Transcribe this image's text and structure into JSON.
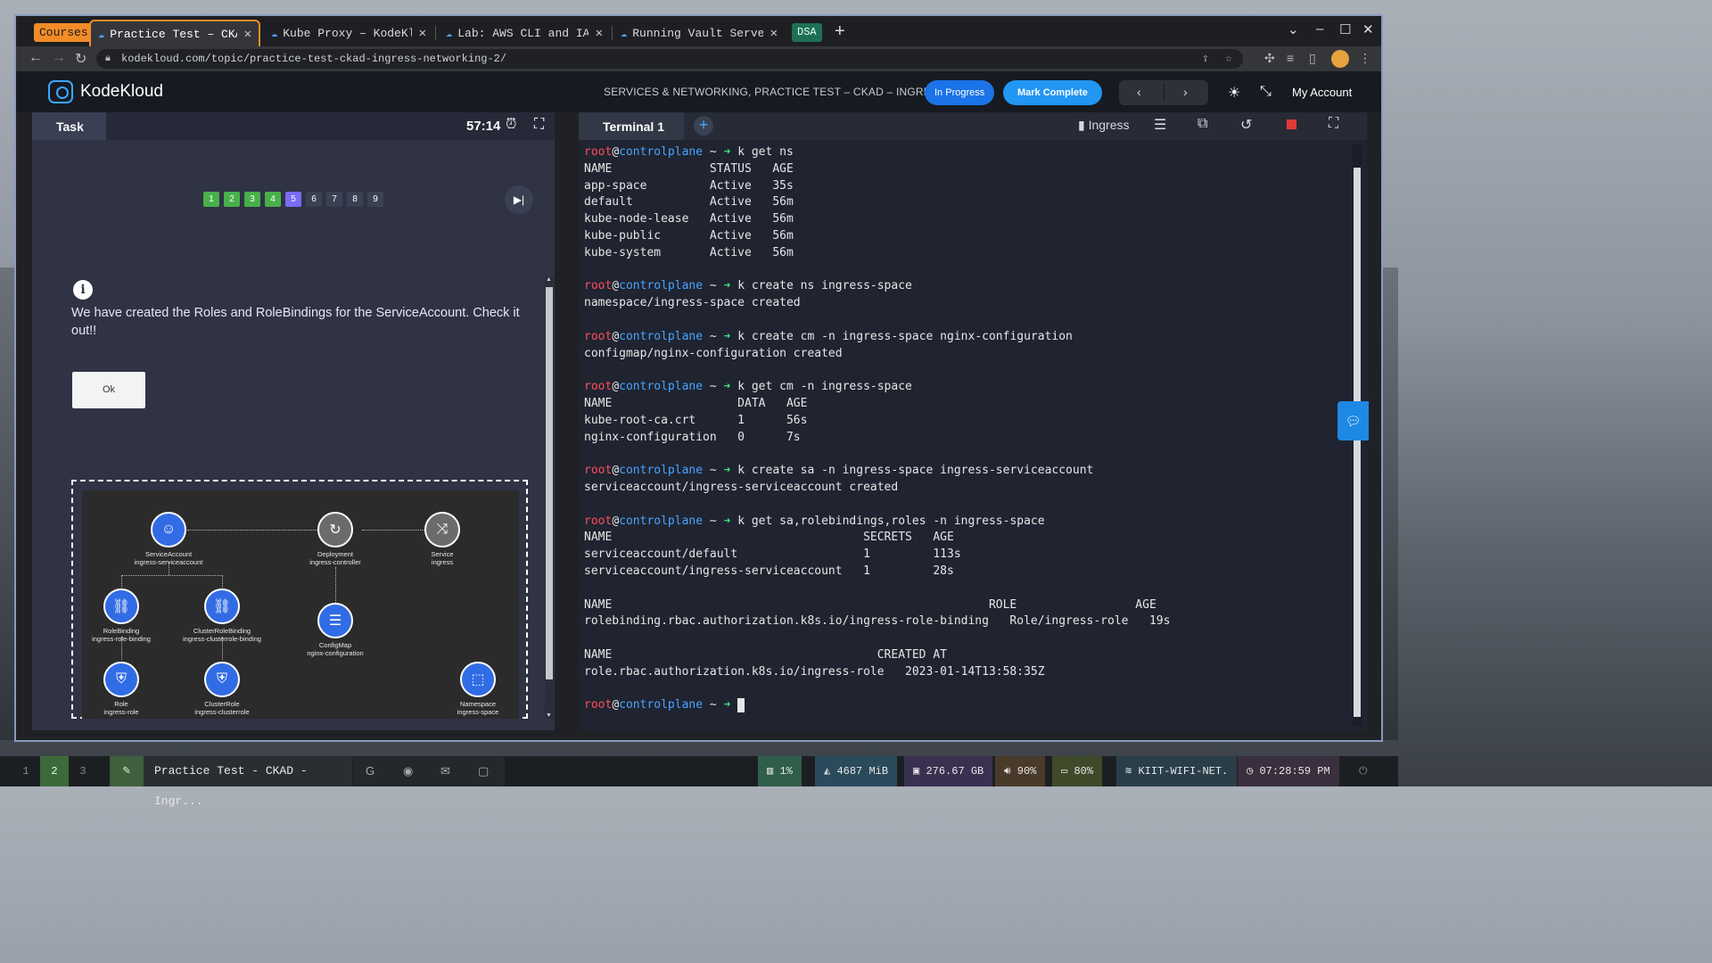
{
  "browser": {
    "courses_label": "Courses",
    "tabs": [
      {
        "title": "Practice Test – CKAD – Ingr"
      },
      {
        "title": "Kube Proxy – KodeKloud"
      },
      {
        "title": "Lab: AWS CLI and IAM – Ko"
      },
      {
        "title": "Running Vault Server (Dev)"
      }
    ],
    "dsa_label": "DSA",
    "url": "kodekloud.com/topic/practice-test-ckad-ingress-networking-2/"
  },
  "header": {
    "brand": "KodeKloud",
    "breadcrumb": "SERVICES & NETWORKING, PRACTICE TEST – CKAD – INGRE...",
    "status_button": "In Progress",
    "complete_button": "Mark Complete",
    "account_label": "My Account"
  },
  "task": {
    "tab_label": "Task",
    "timer": "57:14",
    "questions": [
      {
        "n": "1",
        "state": "done"
      },
      {
        "n": "2",
        "state": "done"
      },
      {
        "n": "3",
        "state": "done"
      },
      {
        "n": "4",
        "state": "done"
      },
      {
        "n": "5",
        "state": "current"
      },
      {
        "n": "6",
        "state": "todo"
      },
      {
        "n": "7",
        "state": "todo"
      },
      {
        "n": "8",
        "state": "todo"
      },
      {
        "n": "9",
        "state": "todo"
      }
    ],
    "message": "We have created the Roles and RoleBindings for the ServiceAccount. Check it out!!",
    "ok_button": "Ok",
    "diagram": {
      "serviceaccount": {
        "kind": "ServiceAccount",
        "name": "ingress-serviceaccount"
      },
      "deployment": {
        "kind": "Deployment",
        "name": "ingress-controller"
      },
      "service": {
        "kind": "Service",
        "name": "ingress"
      },
      "rolebinding": {
        "kind": "RoleBinding",
        "name": "ingress-role-binding"
      },
      "clusterrolebinding": {
        "kind": "ClusterRoleBinding",
        "name": "ingress-clusterrole-binding"
      },
      "configmap": {
        "kind": "ConfigMap",
        "name": "nginx-configuration"
      },
      "role": {
        "kind": "Role",
        "name": "ingress-role"
      },
      "clusterrole": {
        "kind": "ClusterRole",
        "name": "ingress-clusterrole"
      },
      "namespace": {
        "kind": "Namespace",
        "name": "ingress-space"
      }
    }
  },
  "terminal": {
    "tab_label": "Terminal 1",
    "ingress_label": "Ingress",
    "prompt": {
      "user": "root",
      "at": "@",
      "host": "controlplane",
      "tilde": " ~ ",
      "arrow": "➜"
    },
    "lines": [
      {
        "type": "cmd",
        "text": " k get ns"
      },
      {
        "type": "out",
        "text": "NAME              STATUS   AGE"
      },
      {
        "type": "out",
        "text": "app-space         Active   35s"
      },
      {
        "type": "out",
        "text": "default           Active   56m"
      },
      {
        "type": "out",
        "text": "kube-node-lease   Active   56m"
      },
      {
        "type": "out",
        "text": "kube-public       Active   56m"
      },
      {
        "type": "out",
        "text": "kube-system       Active   56m"
      },
      {
        "type": "out",
        "text": ""
      },
      {
        "type": "cmd",
        "text": " k create ns ingress-space"
      },
      {
        "type": "out",
        "text": "namespace/ingress-space created"
      },
      {
        "type": "out",
        "text": ""
      },
      {
        "type": "cmd",
        "text": " k create cm -n ingress-space nginx-configuration"
      },
      {
        "type": "out",
        "text": "configmap/nginx-configuration created"
      },
      {
        "type": "out",
        "text": ""
      },
      {
        "type": "cmd",
        "text": " k get cm -n ingress-space"
      },
      {
        "type": "out",
        "text": "NAME                  DATA   AGE"
      },
      {
        "type": "out",
        "text": "kube-root-ca.crt      1      56s"
      },
      {
        "type": "out",
        "text": "nginx-configuration   0      7s"
      },
      {
        "type": "out",
        "text": ""
      },
      {
        "type": "cmd",
        "text": " k create sa -n ingress-space ingress-serviceaccount"
      },
      {
        "type": "out",
        "text": "serviceaccount/ingress-serviceaccount created"
      },
      {
        "type": "out",
        "text": ""
      },
      {
        "type": "cmd",
        "text": " k get sa,rolebindings,roles -n ingress-space"
      },
      {
        "type": "out",
        "text": "NAME                                    SECRETS   AGE"
      },
      {
        "type": "out",
        "text": "serviceaccount/default                  1         113s"
      },
      {
        "type": "out",
        "text": "serviceaccount/ingress-serviceaccount   1         28s"
      },
      {
        "type": "out",
        "text": ""
      },
      {
        "type": "out",
        "text": "NAME                                                      ROLE                 AGE"
      },
      {
        "type": "out",
        "text": "rolebinding.rbac.authorization.k8s.io/ingress-role-binding   Role/ingress-role   19s"
      },
      {
        "type": "out",
        "text": ""
      },
      {
        "type": "out",
        "text": "NAME                                      CREATED AT"
      },
      {
        "type": "out",
        "text": "role.rbac.authorization.k8s.io/ingress-role   2023-01-14T13:58:35Z"
      },
      {
        "type": "out",
        "text": ""
      },
      {
        "type": "prompt",
        "text": " "
      }
    ]
  },
  "taskbar": {
    "workspaces": [
      "1",
      "2",
      "3"
    ],
    "window_title": "Practice Test - CKAD - Ingr...",
    "cpu": "1%",
    "memory": "4687 MiB",
    "disk": "276.67 GB",
    "volume": "90%",
    "battery": "80%",
    "wifi": "KIIT-WIFI-NET.",
    "clock": "07:28:59 PM"
  },
  "colors": {
    "accent_orange": "#f28c28",
    "kk_blue": "#2196f3",
    "prompt_red": "#ff4d5e",
    "prompt_blue": "#4aa3ff",
    "prompt_green": "#3ddc84",
    "done_green": "#48b04a",
    "current_purple": "#7b6cf6"
  }
}
